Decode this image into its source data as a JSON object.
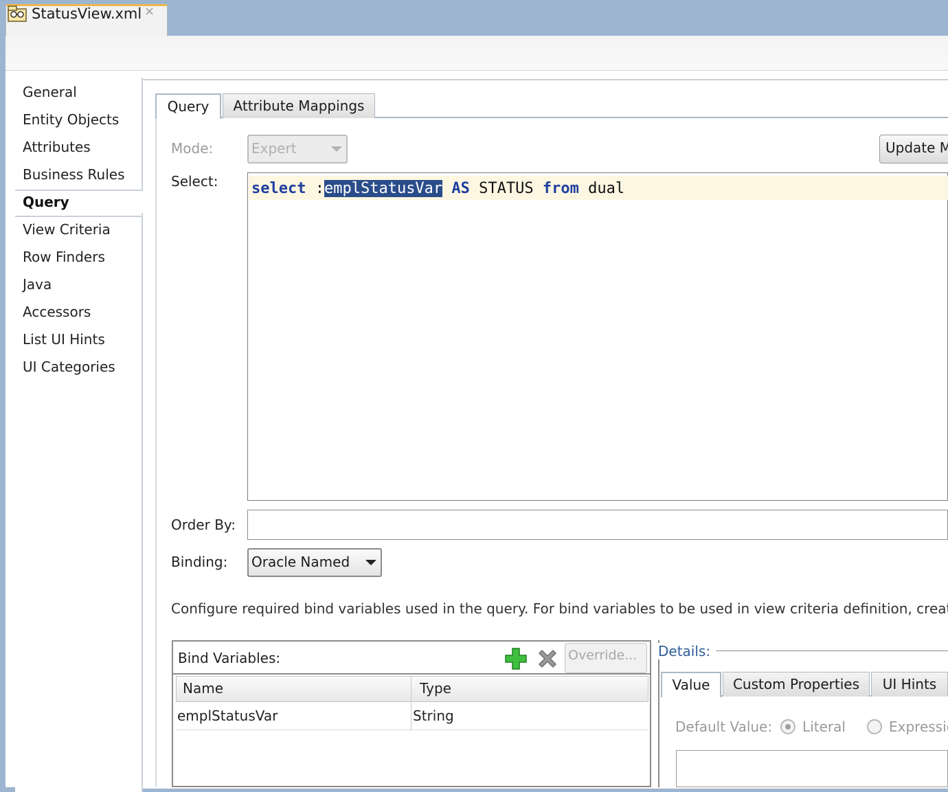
{
  "editor_tab": {
    "title": "StatusView.xml",
    "close": "×",
    "icon": "view-object-icon"
  },
  "nav": {
    "items": [
      {
        "label": "General",
        "active": false
      },
      {
        "label": "Entity Objects",
        "active": false
      },
      {
        "label": "Attributes",
        "active": false
      },
      {
        "label": "Business Rules",
        "active": false
      },
      {
        "label": "Query",
        "active": true
      },
      {
        "label": "View Criteria",
        "active": false
      },
      {
        "label": "Row Finders",
        "active": false
      },
      {
        "label": "Java",
        "active": false
      },
      {
        "label": "Accessors",
        "active": false
      },
      {
        "label": "List UI Hints",
        "active": false
      },
      {
        "label": "UI Categories",
        "active": false
      }
    ]
  },
  "tabs": {
    "query": "Query",
    "attribute_mappings": "Attribute Mappings"
  },
  "form": {
    "mode_label": "Mode:",
    "mode_value": "Expert",
    "update_button": "Update M",
    "select_label": "Select:",
    "sql": {
      "kw_select": "select",
      "colon": " :",
      "bind_var": "emplStatusVar",
      "kw_as": "AS",
      "status": "STATUS",
      "kw_from": "from",
      "dual": "dual"
    },
    "order_by_label": "Order By:",
    "order_by_value": "",
    "binding_label": "Binding:",
    "binding_value": "Oracle Named",
    "info_text": "Configure required bind variables used in the query.  For bind variables to be used in view criteria definition, create th"
  },
  "bind_variables": {
    "title": "Bind Variables:",
    "add_icon": "plus-icon",
    "delete_icon": "delete-x-icon",
    "override_button": "Override...",
    "columns": [
      "Name",
      "Type"
    ],
    "rows": [
      {
        "name": "emplStatusVar",
        "type": "String"
      }
    ]
  },
  "details": {
    "title": "Details:",
    "tabs": [
      "Value",
      "Custom Properties",
      "UI Hints"
    ],
    "default_value_label": "Default Value:",
    "radio_literal": "Literal",
    "radio_expression": "Expressio"
  }
}
